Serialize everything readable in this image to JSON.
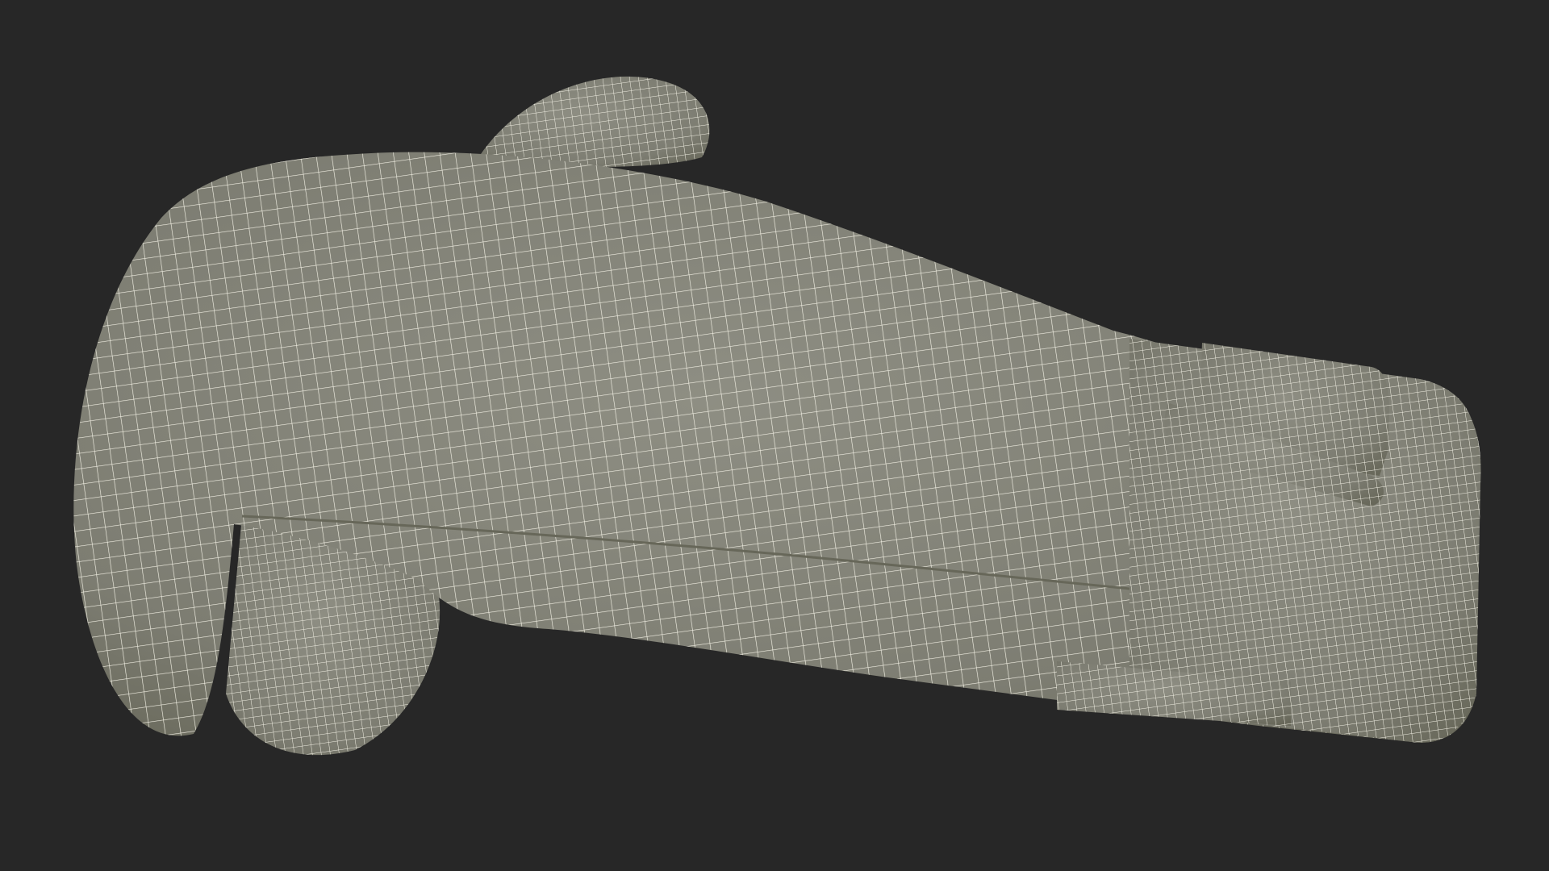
{
  "scene": {
    "subject": "boxing-glove-wireframe",
    "render_mode": "wireframe",
    "colors": {
      "background": "#272727",
      "surface": "#7d7d72",
      "surface_shadow": "#676759",
      "surface_highlight": "#8e8e83",
      "wire": "#f2f0e4"
    }
  }
}
